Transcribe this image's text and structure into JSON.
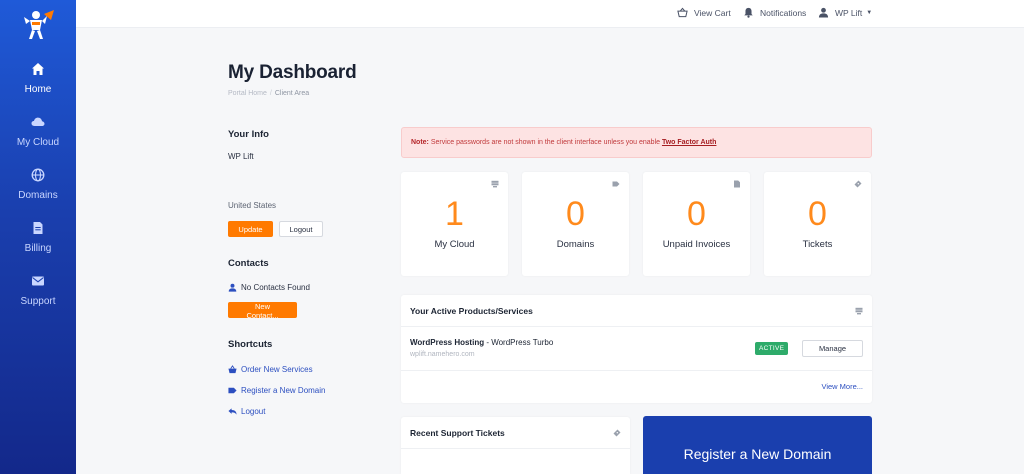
{
  "sidebar": {
    "items": [
      {
        "label": "Home",
        "icon": "home-icon",
        "active": true
      },
      {
        "label": "My Cloud",
        "icon": "cloud-icon",
        "active": false
      },
      {
        "label": "Domains",
        "icon": "globe-icon",
        "active": false
      },
      {
        "label": "Billing",
        "icon": "document-icon",
        "active": false
      },
      {
        "label": "Support",
        "icon": "envelope-icon",
        "active": false
      }
    ]
  },
  "topbar": {
    "view_cart": "View Cart",
    "notifications": "Notifications",
    "user": "WP Lift"
  },
  "page": {
    "title": "My Dashboard",
    "breadcrumb": [
      "Portal Home",
      "Client Area"
    ]
  },
  "your_info": {
    "title": "Your Info",
    "name": "WP Lift",
    "country": "United States",
    "update_label": "Update",
    "logout_label": "Logout"
  },
  "contacts": {
    "title": "Contacts",
    "empty_text": "No Contacts Found",
    "new_contact_label": "New Contact..."
  },
  "shortcuts": {
    "title": "Shortcuts",
    "items": [
      {
        "label": "Order New Services",
        "icon": "basket-icon"
      },
      {
        "label": "Register a New Domain",
        "icon": "tag-icon"
      },
      {
        "label": "Logout",
        "icon": "back-arrow-icon"
      }
    ]
  },
  "alert": {
    "prefix": "Note:",
    "text": " Service passwords are not shown in the client interface unless you enable ",
    "link": "Two Factor Auth"
  },
  "stats": [
    {
      "value": "1",
      "label": "My Cloud",
      "icon": "server-icon"
    },
    {
      "value": "0",
      "label": "Domains",
      "icon": "tag-icon"
    },
    {
      "value": "0",
      "label": "Unpaid Invoices",
      "icon": "document-icon"
    },
    {
      "value": "0",
      "label": "Tickets",
      "icon": "ticket-icon"
    }
  ],
  "products": {
    "title": "Your Active Products/Services",
    "item": {
      "name": "WordPress Hosting",
      "plan": " - WordPress Turbo",
      "domain": "wplift.namehero.com",
      "status": "ACTIVE",
      "manage_label": "Manage"
    },
    "view_more": "View More..."
  },
  "tickets": {
    "title": "Recent Support Tickets"
  },
  "register_card": {
    "label": "Register a New Domain"
  },
  "colors": {
    "accent": "#ff7a00",
    "sidebar": "#1a3fae",
    "link": "#2c4fc0",
    "active_badge": "#2eab6a"
  }
}
